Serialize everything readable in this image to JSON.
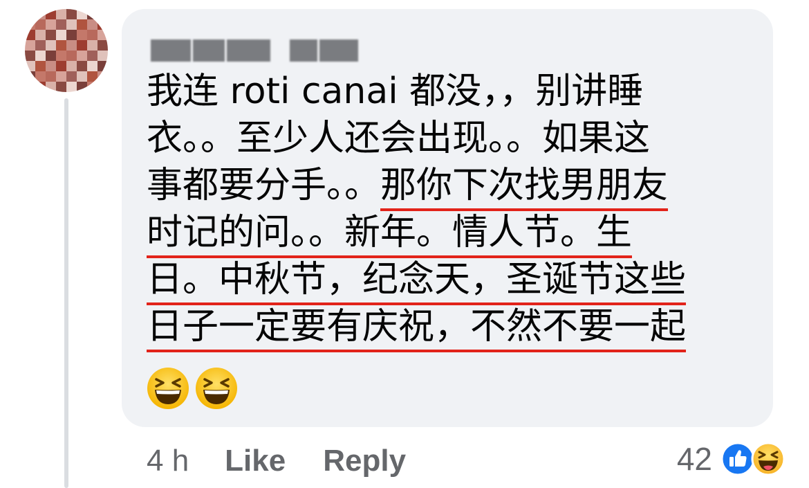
{
  "comment": {
    "author": {
      "avatar_icon": "blurred-avatar",
      "name_redacted": true
    },
    "text_lines": [
      {
        "plain": "我连 roti canai 都没，，别讲睡",
        "hl": ""
      },
      {
        "plain": "衣。。至少人还会出现。。如果这",
        "hl": ""
      },
      {
        "plain": "事都要分手。。",
        "hl": "那你下次找男朋友"
      },
      {
        "plain": "",
        "hl": "时记的问。。新年。情人节。生"
      },
      {
        "plain": "",
        "hl": "日。中秋节，纪念天，圣诞节这些"
      },
      {
        "plain": "",
        "hl": "日子一定要有庆祝，不然不要一起"
      }
    ],
    "emojis": [
      "grinning-squinting-face-icon",
      "grinning-squinting-face-icon"
    ],
    "highlight_color": "#e2231a",
    "bubble_color": "#f0f2f5"
  },
  "actions": {
    "time": "4 h",
    "like_label": "Like",
    "reply_label": "Reply"
  },
  "reactions": {
    "count": "42",
    "icons": [
      "like-reaction-icon",
      "haha-reaction-icon"
    ],
    "like_color": "#1877f2"
  }
}
